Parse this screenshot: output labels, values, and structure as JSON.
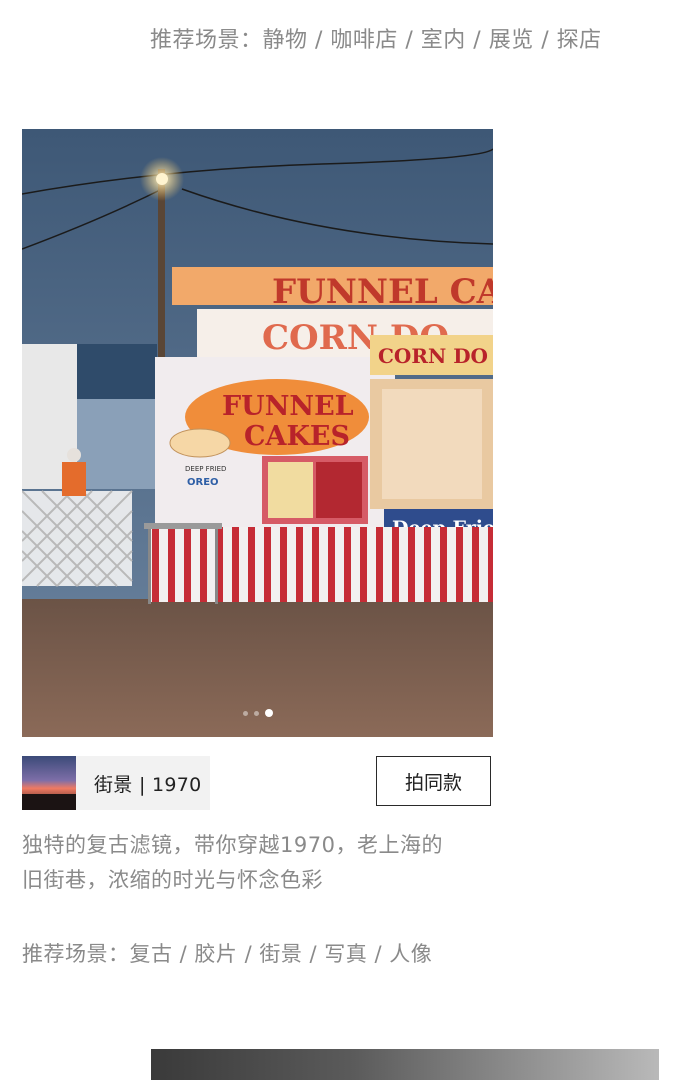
{
  "top_section": {
    "recommended_scenes": "推荐场景：静物 / 咖啡店 / 室内 / 展览 / 探店"
  },
  "photo": {
    "signs": {
      "funnel_top": "FUNNEL CA",
      "corn_top": "CORN DO",
      "corn_dogs": "CORN DO",
      "funnel_cakes_line1": "FUNNEL",
      "funnel_cakes_line2": "CAKES",
      "deep_fried": "DEEP FRIED",
      "oreo": "OREO",
      "deep_fried_banner": "Deep Fried"
    },
    "carousel": {
      "count": 3,
      "active_index": 2
    }
  },
  "filter": {
    "label": "街景 | 1970",
    "button_label": "拍同款"
  },
  "description": {
    "line1": "独特的复古滤镜，带你穿越1970，老上海的",
    "line2": "旧街巷，浓缩的时光与怀念色彩"
  },
  "bottom_section": {
    "recommended_scenes": "推荐场景：复古 / 胶片 / 街景 / 写真 / 人像"
  },
  "colors": {
    "text_gray": "#8a8a8a",
    "button_border": "#2a2a2a",
    "chip_bg": "#f2f2f2"
  }
}
